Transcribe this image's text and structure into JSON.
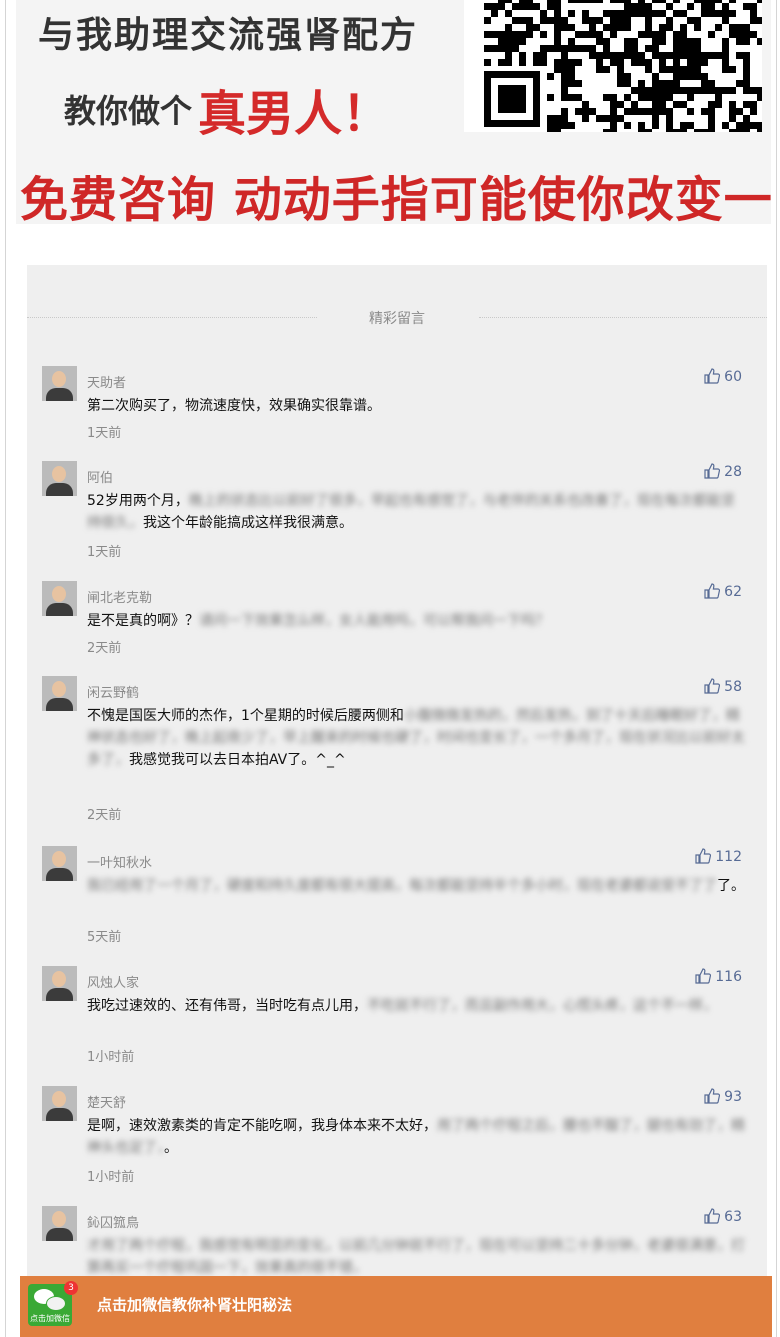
{
  "banner": {
    "line1": "与我助理交流强肾配方",
    "line2_prefix": "教你做个",
    "line2_highlight": "真男人！",
    "line3": "免费咨询 动动手指可能使你改变一生"
  },
  "section": {
    "title": "精彩留言"
  },
  "comments": [
    {
      "nick": "天助者",
      "likes": "60",
      "text": "第二次购买了，物流速度快，效果确实很靠谱。",
      "blurred": "",
      "tail": "",
      "time": "1天前"
    },
    {
      "nick": "阿伯",
      "likes": "28",
      "text": "52岁用两个月，",
      "blurred": "晚上的状态比以前好了很多，早起也有感觉了，与老伴的关系也改善了，现在每次都能坚持很久，",
      "tail": "我这个年龄能搞成这样我很满意。",
      "time": "1天前"
    },
    {
      "nick": "闸北老克勒",
      "likes": "62",
      "text": "是不是真的啊》？",
      "blurred": "请问一下效果怎么样，女人能用吗，可以帮我问一下吗？",
      "tail": "",
      "time": "2天前"
    },
    {
      "nick": "闲云野鹤",
      "likes": "58",
      "text": "不愧是国医大师的杰作，1个星期的时候后腰两侧和",
      "blurred": "小腹微微发热的，然后发热，到了十天后睡眠好了，精神状态也好了，晚上起夜少了，早上醒来的时候也硬了，时间也变长了，一个多月了，现在状况比以前好太多了，",
      "tail": "我感觉我可以去日本拍AV了。^_^",
      "time": "2天前"
    },
    {
      "nick": "一叶知秋水",
      "likes": "112",
      "text": "",
      "blurred": "我已经用了一个月了，硬度和持久度都有很大提高，每次都能坚持半个多小时，现在老婆都说受不了了",
      "tail": "了。",
      "time": "5天前"
    },
    {
      "nick": "风烛人家",
      "likes": "116",
      "text": "我吃过速效的、还有伟哥，当时吃有点儿用，",
      "blurred": "不吃就不行了，而且副作用大，心慌头疼，这个不一样，",
      "tail": "",
      "time": "1小时前"
    },
    {
      "nick": "楚天舒",
      "likes": "93",
      "text": "是啊，速效激素类的肯定不能吃啊，我身体本来不太好，",
      "blurred": "用了两个疗程之后，腰也不酸了，腿也有劲了，精神头也足了，",
      "tail": "。",
      "time": "1小时前"
    },
    {
      "nick": "鈊囚箛鳥",
      "likes": "63",
      "text": "",
      "blurred": "才用了两个疗程，我感觉有明显的变化，以前几分钟就不行了，现在可以坚持二十多分钟，老婆很满意，打算再买一个疗程巩固一下，效果真的很不错，",
      "tail": "",
      "time": ""
    }
  ],
  "wechat": {
    "badge": "3",
    "icon_caption": "点击加微信",
    "cta": "点击加微信教你补肾壮阳秘法"
  },
  "colors": {
    "accent_red": "#cf2727",
    "link_blue": "#576b95",
    "cta_orange": "#e07f3f",
    "wechat_green": "#3aa935"
  }
}
